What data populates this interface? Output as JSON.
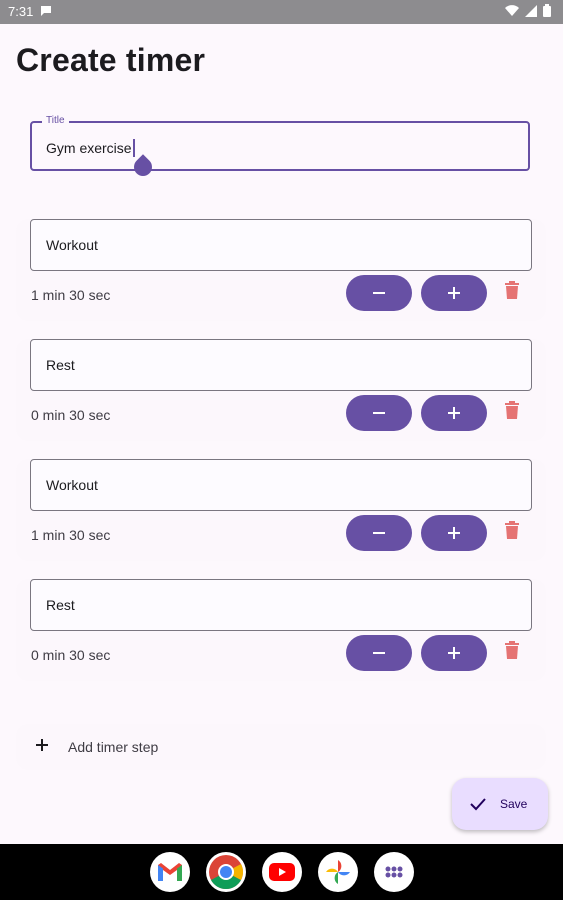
{
  "status_bar": {
    "time": "7:31"
  },
  "page": {
    "title": "Create timer"
  },
  "title_field": {
    "label": "Title",
    "value": "Gym exercise"
  },
  "steps": [
    {
      "name": "Workout",
      "duration": "1 min 30 sec"
    },
    {
      "name": "Rest",
      "duration": "0 min 30 sec"
    },
    {
      "name": "Workout",
      "duration": "1 min 30 sec"
    },
    {
      "name": "Rest",
      "duration": "0 min 30 sec"
    }
  ],
  "buttons": {
    "decrement": "−",
    "increment": "+"
  },
  "add_step": {
    "label": "Add timer step"
  },
  "fab": {
    "label": "Save"
  },
  "dock": {
    "apps": [
      "Gmail",
      "Chrome",
      "YouTube",
      "Photos",
      "App drawer"
    ]
  },
  "colors": {
    "accent": "#6750a4",
    "delete": "#e57373",
    "fab_bg": "#e9ddff",
    "status_bar": "#8d8c8f"
  }
}
